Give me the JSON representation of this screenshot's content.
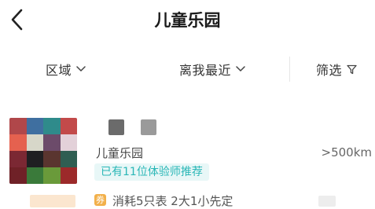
{
  "header": {
    "title": "儿童乐园",
    "back_icon": "chevron-left-icon"
  },
  "filters": {
    "area_label": "区域",
    "nearest_label": "离我最近",
    "filter_label": "筛选",
    "area_icon": "chevron-down-icon",
    "nearest_icon": "chevron-down-icon",
    "filter_icon": "filter-funnel-icon"
  },
  "listing": {
    "name": "儿童乐园",
    "distance": ">500km",
    "badge": "已有11位体验师推荐",
    "promo_text": "消耗5只表 2大1小先定",
    "promo_icon": "券",
    "thumbnail_colors": [
      "#b0474a",
      "#3f6fa0",
      "#2f8b8b",
      "#c24a4a",
      "#e5614f",
      "#d7d7c9",
      "#6c4b6a",
      "#e3d1d9",
      "#7b2833",
      "#1f1f22",
      "#5a352f",
      "#2f5e52",
      "#6f2127",
      "#3a7a3a",
      "#6a9a3a",
      "#9c2a2a"
    ],
    "accent_color": "#2ab7b7"
  }
}
